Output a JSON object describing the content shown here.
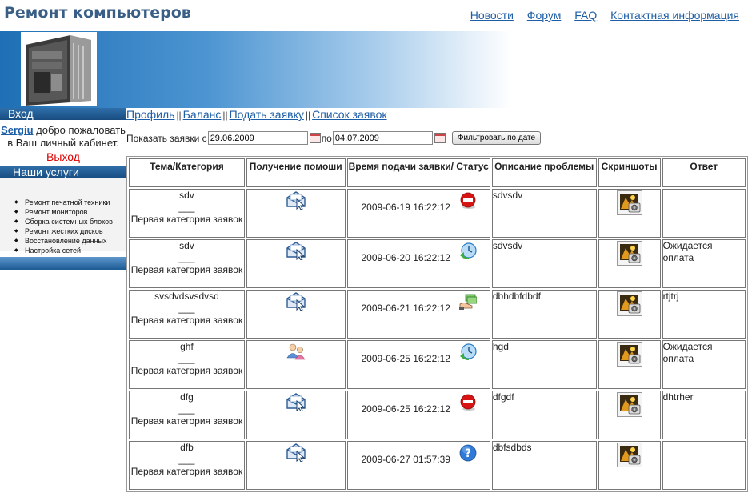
{
  "site": {
    "title": "Ремонт компьютеров"
  },
  "top_nav": [
    "Новости",
    "Форум",
    "FAQ",
    "Контактная информация"
  ],
  "sidebar": {
    "login_header": "Вход",
    "username": "Sergiu",
    "welcome_text": "добро пожаловать в Ваш личный кабинет.",
    "logout": "Выход",
    "services_header": "Наши услуги",
    "services": [
      "Ремонт печатной техники",
      "Ремонт мониторов",
      "Сборка системных блоков",
      "Ремонт жестких дисков",
      "Восстановление данных",
      "Настройка сетей"
    ]
  },
  "subnav": {
    "links": [
      "Профиль",
      "Баланс",
      "Подать заявку",
      "Список заявок"
    ],
    "separator": "||"
  },
  "filter": {
    "label_from": "Показать заявки с",
    "date_from": "29.06.2009",
    "label_to": "по",
    "date_to": "04.07.2009",
    "button": "Фильтровать по дате"
  },
  "table": {
    "headers": [
      "Тема/Категория",
      "Получение помоши",
      "Время подачи заявки/ Статус",
      "Описание проблемы",
      "Скриншоты",
      "Ответ"
    ],
    "rows": [
      {
        "topic": "sdv",
        "divider": "___",
        "category": "Первая категория заявок",
        "get_icon": "envelope-icon",
        "time": "2009-06-19 16:22:12",
        "status_icon": "stop-icon",
        "description": "sdvsdv",
        "answer": ""
      },
      {
        "topic": "sdv",
        "divider": "___",
        "category": "Первая категория заявок",
        "get_icon": "envelope-icon",
        "time": "2009-06-20 16:22:12",
        "status_icon": "clock-icon",
        "description": "sdvsdv",
        "answer": "Ожидается оплата"
      },
      {
        "topic": "svsdvdsvsdvsd",
        "divider": "___",
        "category": "Первая категория заявок",
        "get_icon": "envelope-icon",
        "time": "2009-06-21 16:22:12",
        "status_icon": "money-hand-icon",
        "description": "dbhdbfdbdf",
        "answer": "rtjtrj"
      },
      {
        "topic": "ghf",
        "divider": "___",
        "category": "Первая категория заявок",
        "get_icon": "users-icon",
        "time": "2009-06-25 16:22:12",
        "status_icon": "clock-icon",
        "description": "hgd",
        "answer": "Ожидается оплата"
      },
      {
        "topic": "dfg",
        "divider": "___",
        "category": "Первая категория заявок",
        "get_icon": "envelope-icon",
        "time": "2009-06-25 16:22:12",
        "status_icon": "stop-icon",
        "description": "dfgdf",
        "answer": "dhtrher"
      },
      {
        "topic": "dfb",
        "divider": "___",
        "category": "Первая категория заявок",
        "get_icon": "envelope-icon",
        "time": "2009-06-27 01:57:39",
        "status_icon": "question-icon",
        "description": "dbfsdbds",
        "answer": ""
      }
    ]
  }
}
